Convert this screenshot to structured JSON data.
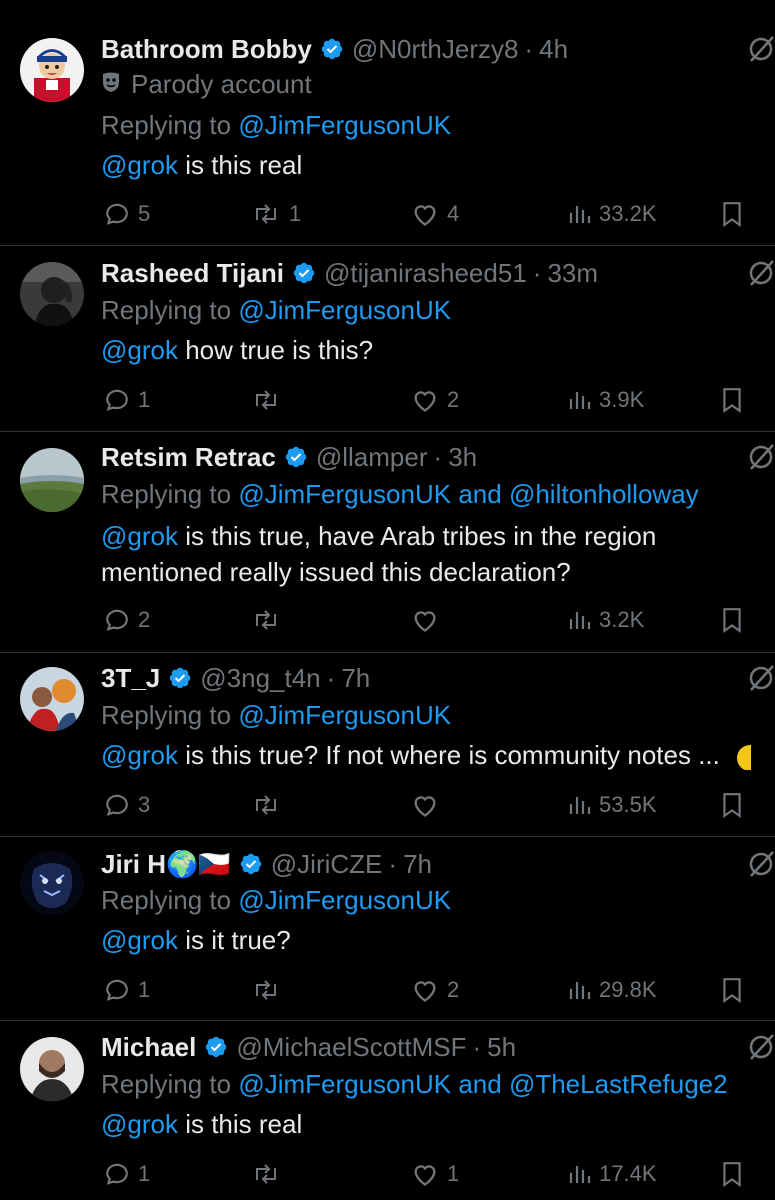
{
  "tweets": [
    {
      "name": "Bathroom Bobby",
      "handle": "@N0rthJerzy8",
      "time": "4h",
      "badge": "Parody account",
      "replying_prefix": "Replying to",
      "replying_to": "@JimFergusonUK",
      "replying_and": "",
      "replying_to2": "",
      "mention": "@grok",
      "text": " is this real",
      "replies": "5",
      "reposts": "1",
      "likes": "4",
      "views": "33.2K",
      "avatar_icon": "cartoon-hockey-avatar"
    },
    {
      "name": "Rasheed Tijani",
      "handle": "@tijanirasheed51",
      "time": "33m",
      "replying_prefix": "Replying to",
      "replying_to": "@JimFergusonUK",
      "replying_and": "",
      "replying_to2": "",
      "mention": "@grok",
      "text": " how true is this?",
      "replies": "1",
      "reposts": "",
      "likes": "2",
      "views": "3.9K",
      "avatar_icon": "photo-avatar"
    },
    {
      "name": "Retsim Retrac",
      "handle": "@llamper",
      "time": "3h",
      "replying_prefix": "Replying to",
      "replying_to": "@JimFergusonUK",
      "replying_and": " and ",
      "replying_to2": "@hiltonholloway",
      "mention": "@grok",
      "text": " is this true, have Arab tribes in the region mentioned really issued this declaration?",
      "replies": "2",
      "reposts": "",
      "likes": "",
      "views": "3.2K",
      "avatar_icon": "landscape-avatar"
    },
    {
      "name": "3T_J",
      "handle": "@3ng_t4n",
      "time": "7h",
      "replying_prefix": "Replying to",
      "replying_to": "@JimFergusonUK",
      "replying_and": "",
      "replying_to2": "",
      "mention": "@grok",
      "text": " is this true? If not where is community notes ...",
      "replies": "3",
      "reposts": "",
      "likes": "",
      "views": "53.5K",
      "avatar_icon": "photo-avatar"
    },
    {
      "name": "Jiri H🌍🇨🇿",
      "handle": "@JiriCZE",
      "time": "7h",
      "replying_prefix": "Replying to",
      "replying_to": "@JimFergusonUK",
      "replying_and": "",
      "replying_to2": "",
      "mention": "@grok",
      "text": " is it true?",
      "replies": "1",
      "reposts": "",
      "likes": "2",
      "views": "29.8K",
      "avatar_icon": "tiger-avatar"
    },
    {
      "name": "Michael",
      "handle": "@MichaelScottMSF",
      "time": "5h",
      "replying_prefix": "Replying to",
      "replying_to": "@JimFergusonUK",
      "replying_and": " and ",
      "replying_to2": "@TheLastRefuge2",
      "mention": "@grok",
      "text": " is this real",
      "replies": "1",
      "reposts": "",
      "likes": "1",
      "views": "17.4K",
      "avatar_icon": "photo-avatar"
    }
  ],
  "colors": {
    "background": "#000000",
    "text": "#e7e9ea",
    "muted": "#71767b",
    "link": "#1d9bf0",
    "verified": "#1d9bf0",
    "divider": "#2f3336"
  }
}
